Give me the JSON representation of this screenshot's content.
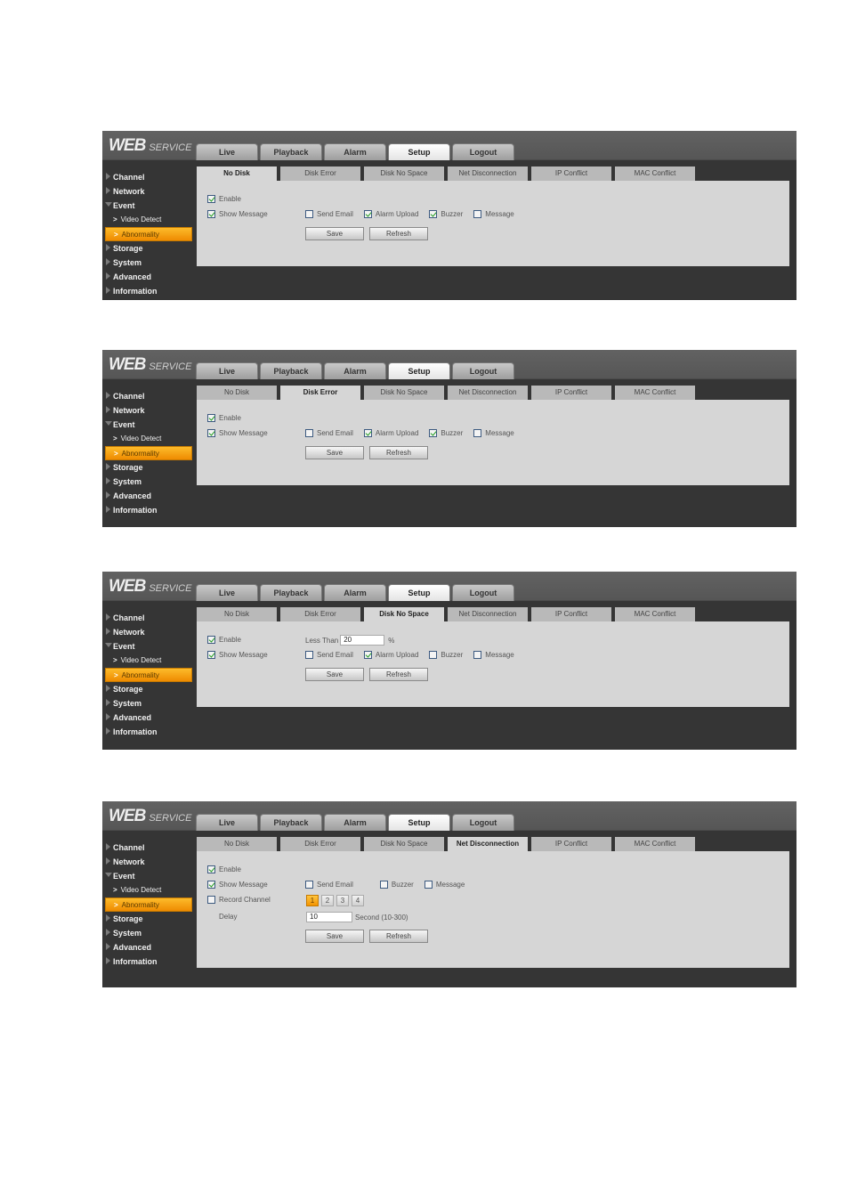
{
  "app": {
    "logo_bold": "WEB",
    "logo_light": "SERVICE"
  },
  "main_tabs": [
    "Live",
    "Playback",
    "Alarm",
    "Setup",
    "Logout"
  ],
  "main_tab_active": "Setup",
  "sidebar": {
    "items": [
      "Channel",
      "Network",
      "Event",
      "Storage",
      "System",
      "Advanced",
      "Information"
    ],
    "event_sub": [
      "Video Detect",
      "Abnormality"
    ],
    "active_sub": "Abnormality"
  },
  "sub_tabs": [
    "No Disk",
    "Disk Error",
    "Disk No Space",
    "Net Disconnection",
    "IP Conflict",
    "MAC Conflict"
  ],
  "labels": {
    "enable": "Enable",
    "show_message": "Show Message",
    "send_email": "Send Email",
    "alarm_upload": "Alarm Upload",
    "buzzer": "Buzzer",
    "message": "Message",
    "record_channel": "Record Channel",
    "delay": "Delay",
    "less_than": "Less Than",
    "percent": "%",
    "delay_unit": "Second (10-300)",
    "save": "Save",
    "refresh": "Refresh"
  },
  "screens": [
    {
      "active_tab": "No Disk",
      "enable": true,
      "show_message": true,
      "send_email": false,
      "alarm_upload": true,
      "buzzer": true,
      "message": false
    },
    {
      "active_tab": "Disk Error",
      "enable": true,
      "show_message": true,
      "send_email": false,
      "alarm_upload": true,
      "buzzer": true,
      "message": false
    },
    {
      "active_tab": "Disk No Space",
      "enable": true,
      "less_than_value": "20",
      "show_message": true,
      "send_email": false,
      "alarm_upload": true,
      "buzzer": false,
      "message": false
    },
    {
      "active_tab": "Net Disconnection",
      "enable": true,
      "show_message": true,
      "send_email": false,
      "buzzer": false,
      "message": false,
      "record_channel": false,
      "channels": [
        "1",
        "2",
        "3",
        "4"
      ],
      "channel_selected": "1",
      "delay_value": "10"
    }
  ]
}
